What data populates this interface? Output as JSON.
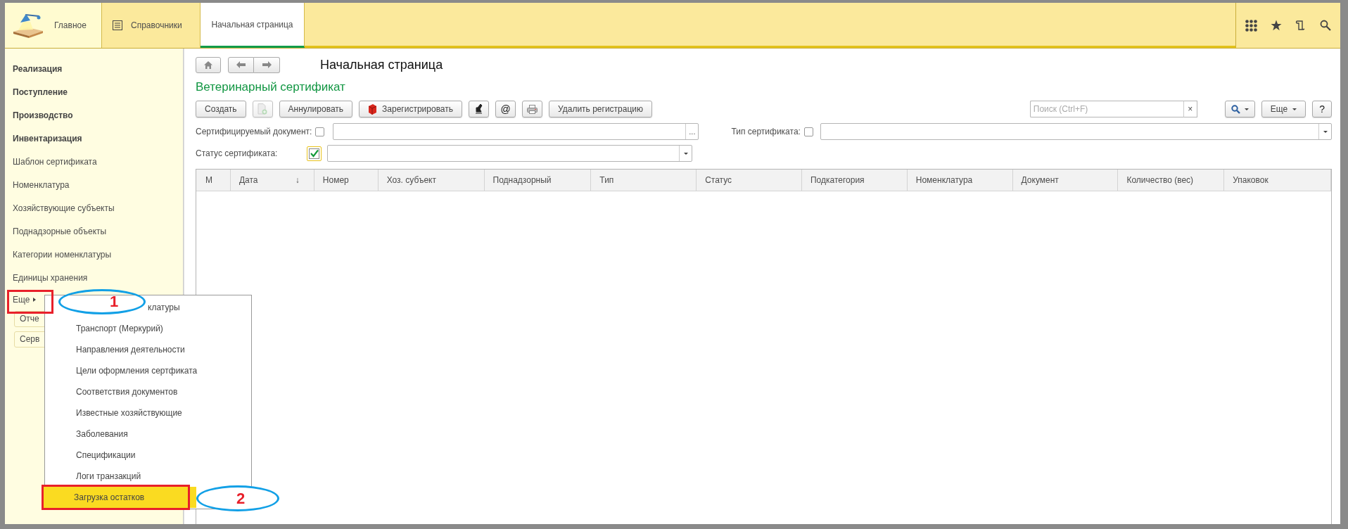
{
  "top_bar": {
    "tabs": [
      {
        "label": "Главное",
        "selected": false,
        "kind": "home"
      },
      {
        "label": "Справочники",
        "selected": false,
        "kind": "section"
      },
      {
        "label": "Начальная страница",
        "selected": true,
        "kind": "page"
      }
    ]
  },
  "sidebar": {
    "items": [
      {
        "label": "Реализация",
        "kind": "group"
      },
      {
        "label": "Поступление",
        "kind": "group"
      },
      {
        "label": "Производство",
        "kind": "group"
      },
      {
        "label": "Инвентаризация",
        "kind": "group"
      },
      {
        "label": "Шаблон сертификата",
        "kind": "link"
      },
      {
        "label": "Номенклатура",
        "kind": "link"
      },
      {
        "label": "Хозяйствующие субъекты",
        "kind": "link"
      },
      {
        "label": "Поднадзорные объекты",
        "kind": "link"
      },
      {
        "label": "Категории номенклатуры",
        "kind": "link"
      },
      {
        "label": "Единицы хранения",
        "kind": "link"
      }
    ],
    "more": "Еще",
    "buttons": [
      "Отче",
      "Серв"
    ]
  },
  "page": {
    "title": "Начальная страница"
  },
  "form": {
    "title": "Ветеринарный сертификат",
    "toolbar": [
      {
        "kind": "text",
        "label": "Создать"
      },
      {
        "kind": "doc"
      },
      {
        "kind": "text",
        "label": "Аннулировать"
      },
      {
        "kind": "register",
        "label": "Зарегистрировать"
      },
      {
        "kind": "seal"
      },
      {
        "kind": "glyph",
        "label": "@"
      },
      {
        "kind": "printer"
      },
      {
        "kind": "text",
        "label": "Удалить регистрацию"
      }
    ],
    "search": {
      "placeholder": "Поиск (Ctrl+F)",
      "clear": "×"
    },
    "more_button": "Еще",
    "help_button": "?",
    "filter_rows": [
      {
        "filters": [
          {
            "label": "Сертифицируемый документ:",
            "checked": false,
            "kind": "choice",
            "button": "..."
          },
          {
            "label": "Тип сертификата:",
            "checked": false,
            "kind": "dropdown"
          }
        ]
      },
      {
        "filters": [
          {
            "label": "Статус сертификата:",
            "checked": true,
            "kind": "dropdown"
          }
        ]
      }
    ],
    "table": {
      "columns": [
        {
          "label": "М"
        },
        {
          "label": "Дата",
          "sort": "↓"
        },
        {
          "label": "Номер"
        },
        {
          "label": "Хоз. субъект"
        },
        {
          "label": "Поднадзорный"
        },
        {
          "label": "Тип"
        },
        {
          "label": "Статус"
        },
        {
          "label": "Подкатегория"
        },
        {
          "label": "Номенклатура"
        },
        {
          "label": "Документ"
        },
        {
          "label": "Количество (вес)"
        },
        {
          "label": "Упаковок"
        }
      ]
    }
  },
  "popup_menu": {
    "items": [
      {
        "label": "клатуры",
        "selected": false,
        "covered": true
      },
      {
        "label": "Транспорт (Меркурий)",
        "selected": false,
        "covered": false
      },
      {
        "label": "Направления деятельности",
        "selected": false,
        "covered": false
      },
      {
        "label": "Цели оформления сертфиката",
        "selected": false,
        "covered": false
      },
      {
        "label": "Соответствия документов",
        "selected": false,
        "covered": false
      },
      {
        "label": "Известные хозяйствующие",
        "selected": false,
        "covered": false
      },
      {
        "label": "Заболевания",
        "selected": false,
        "covered": false
      },
      {
        "label": "Спецификации",
        "selected": false,
        "covered": false
      },
      {
        "label": "Логи транзакций",
        "selected": false,
        "covered": false
      },
      {
        "label": "Загрузка остатков",
        "selected": true,
        "covered": false
      }
    ]
  },
  "annotations": [
    {
      "number": "1"
    },
    {
      "number": "2"
    }
  ]
}
